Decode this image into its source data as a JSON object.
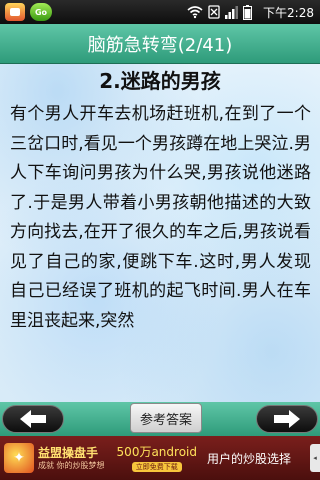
{
  "status_bar": {
    "time": "下午2:28",
    "icons": [
      "app-notification-icon",
      "green-app-icon",
      "wifi-icon",
      "no-sim-icon",
      "signal-icon",
      "battery-icon"
    ],
    "green_app_text": "Go"
  },
  "header": {
    "title": "脑筋急转弯(2/41)"
  },
  "content": {
    "heading": "2.迷路的男孩",
    "body": "有个男人开车去机场赶班机,在到了一个三岔口时,看见一个男孩蹲在地上哭泣.男人下车询问男孩为什么哭,男孩说他迷路了.于是男人带着小男孩朝他描述的大致方向找去,在开了很久的车之后,男孩说看见了自己的家,便跳下车.这时,男人发现自己已经误了班机的起飞时间.男人在车里沮丧起来,突然"
  },
  "bottom_bar": {
    "prev_icon": "arrow-left-icon",
    "next_icon": "arrow-right-icon",
    "answer_label": "参考答案"
  },
  "ad": {
    "brand_name": "益盟操盘手",
    "brand_sub": "成就 你的炒股梦想",
    "mid_text": "500万android",
    "mid_button": "立即免费下载",
    "right_text": "用户的炒股选择",
    "colors": {
      "background": "#6a1a18",
      "accent": "#ffe25a"
    }
  },
  "colors": {
    "header_green": "#3daa88",
    "content_bg": "#e3f0fa"
  }
}
